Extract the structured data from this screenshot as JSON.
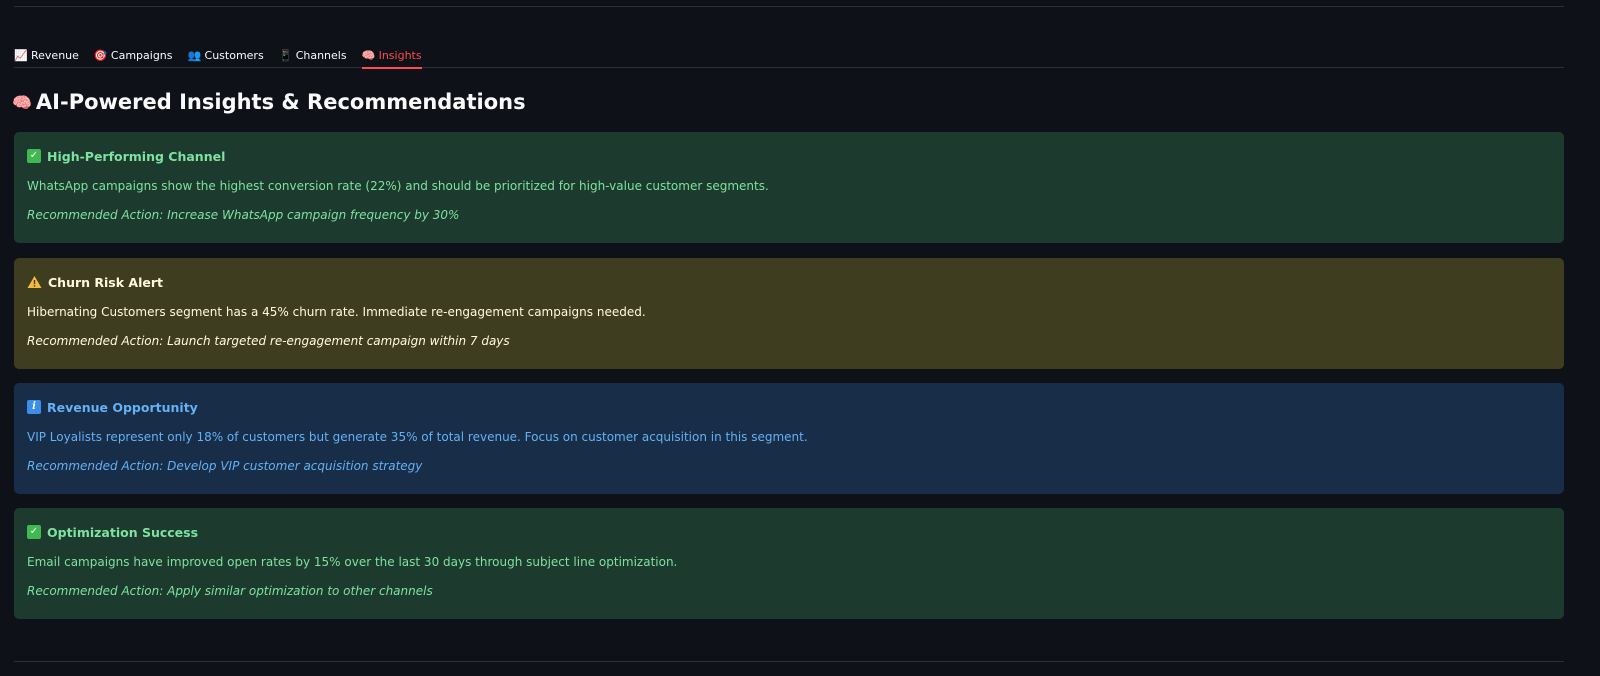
{
  "tabs": [
    {
      "icon": "📈",
      "label": "Revenue",
      "active": false
    },
    {
      "icon": "🎯",
      "label": "Campaigns",
      "active": false
    },
    {
      "icon": "👥",
      "label": "Customers",
      "active": false
    },
    {
      "icon": "📱",
      "label": "Channels",
      "active": false
    },
    {
      "icon": "🧠",
      "label": "Insights",
      "active": true
    }
  ],
  "page": {
    "title_icon": "🧠",
    "title": "AI-Powered Insights & Recommendations"
  },
  "cards": [
    {
      "kind": "success",
      "icon": "check-icon",
      "title": "High-Performing Channel",
      "body": "WhatsApp campaigns show the highest conversion rate (22%) and should be prioritized for high-value customer segments.",
      "action": "Recommended Action: Increase WhatsApp campaign frequency by 30%"
    },
    {
      "kind": "warning",
      "icon": "warning-icon",
      "title": "Churn Risk Alert",
      "body": "Hibernating Customers segment has a 45% churn rate. Immediate re-engagement campaigns needed.",
      "action": "Recommended Action: Launch targeted re-engagement campaign within 7 days"
    },
    {
      "kind": "info",
      "icon": "info-icon",
      "title": "Revenue Opportunity",
      "body": "VIP Loyalists represent only 18% of customers but generate 35% of total revenue. Focus on customer acquisition in this segment.",
      "action": "Recommended Action: Develop VIP customer acquisition strategy"
    },
    {
      "kind": "success",
      "icon": "check-icon",
      "title": "Optimization Success",
      "body": "Email campaigns have improved open rates by 15% over the last 30 days through subject line optimization.",
      "action": "Recommended Action: Apply similar optimization to other channels"
    }
  ],
  "colors": {
    "background": "#0e1117",
    "active_tab": "#ff4b4b",
    "success_bg": "#1c3a2d",
    "success_text": "#7ee2a0",
    "warning_bg": "#3f3d1f",
    "warning_text": "#fffbe0",
    "info_bg": "#172d48",
    "info_text": "#64b1f5"
  }
}
